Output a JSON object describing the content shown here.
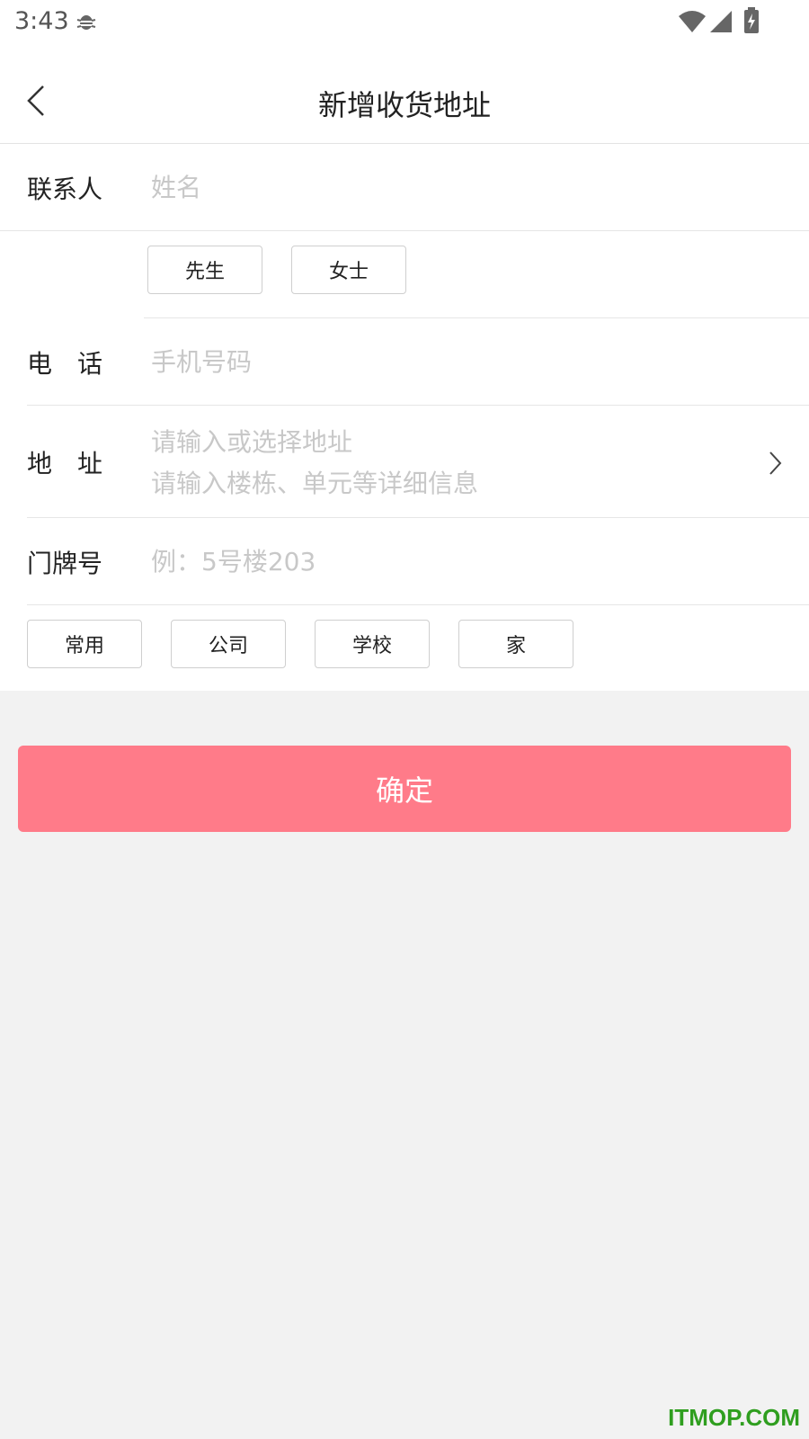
{
  "status_bar": {
    "time": "3:43"
  },
  "header": {
    "title": "新增收货地址",
    "back": "back-arrow-icon"
  },
  "form": {
    "contact": {
      "label": "联系人",
      "placeholder": "姓名"
    },
    "gender": {
      "options": [
        "先生",
        "女士"
      ]
    },
    "phone": {
      "label": "电　话",
      "placeholder": "手机号码"
    },
    "address": {
      "label": "地　址",
      "placeholder_line1": "请输入或选择地址",
      "placeholder_line2": "请输入楼栋、单元等详细信息"
    },
    "door": {
      "label": "门牌号",
      "placeholder": "例：5号楼203"
    },
    "tags": [
      "常用",
      "公司",
      "学校",
      "家"
    ]
  },
  "submit_label": "确定",
  "watermark": "ITMOP.COM",
  "colors": {
    "primary": "#ff7b89",
    "placeholder": "#c8c8c8",
    "divider": "#e6e6e6",
    "page_bg": "#f2f2f2"
  }
}
